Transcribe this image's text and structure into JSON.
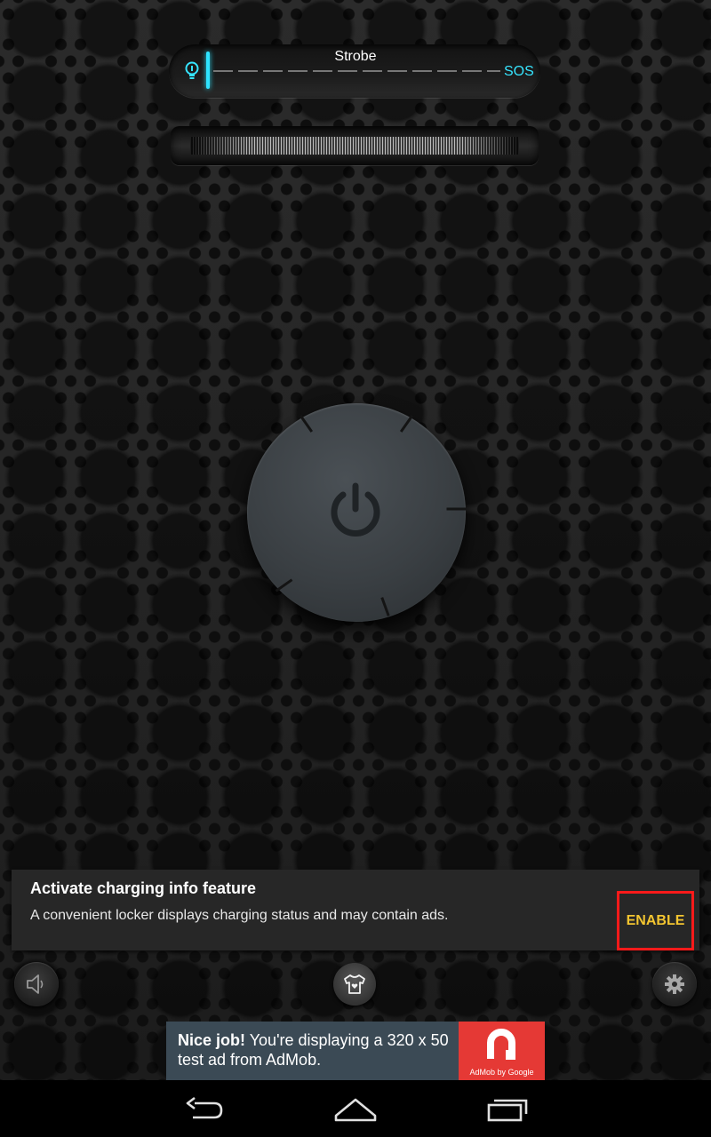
{
  "mode_slider": {
    "label": "Strobe",
    "end_label": "SOS",
    "value": 0,
    "accent_color": "#2ee3ff",
    "start_icon": "lightbulb-icon"
  },
  "frequency_wheel": {
    "icon": "scroll-wheel"
  },
  "power_button": {
    "icon": "power-icon",
    "state": "off"
  },
  "notice": {
    "title": "Activate charging info feature",
    "body": "A convenient locker displays charging status and may contain ads.",
    "action_label": "ENABLE",
    "action_color": "#f3c530",
    "highlight_color": "#ff1a1a"
  },
  "bottom_controls": {
    "left_icon": "speaker-icon",
    "center_icon": "tshirt-heart-icon",
    "right_icon": "gear-icon"
  },
  "ad": {
    "bold_text": "Nice job!",
    "text": " You're displaying a 320 x 50 test ad from AdMob.",
    "logo_caption": "AdMob by Google"
  },
  "nav": {
    "back_icon": "back-icon",
    "home_icon": "home-icon",
    "recents_icon": "recents-icon"
  }
}
